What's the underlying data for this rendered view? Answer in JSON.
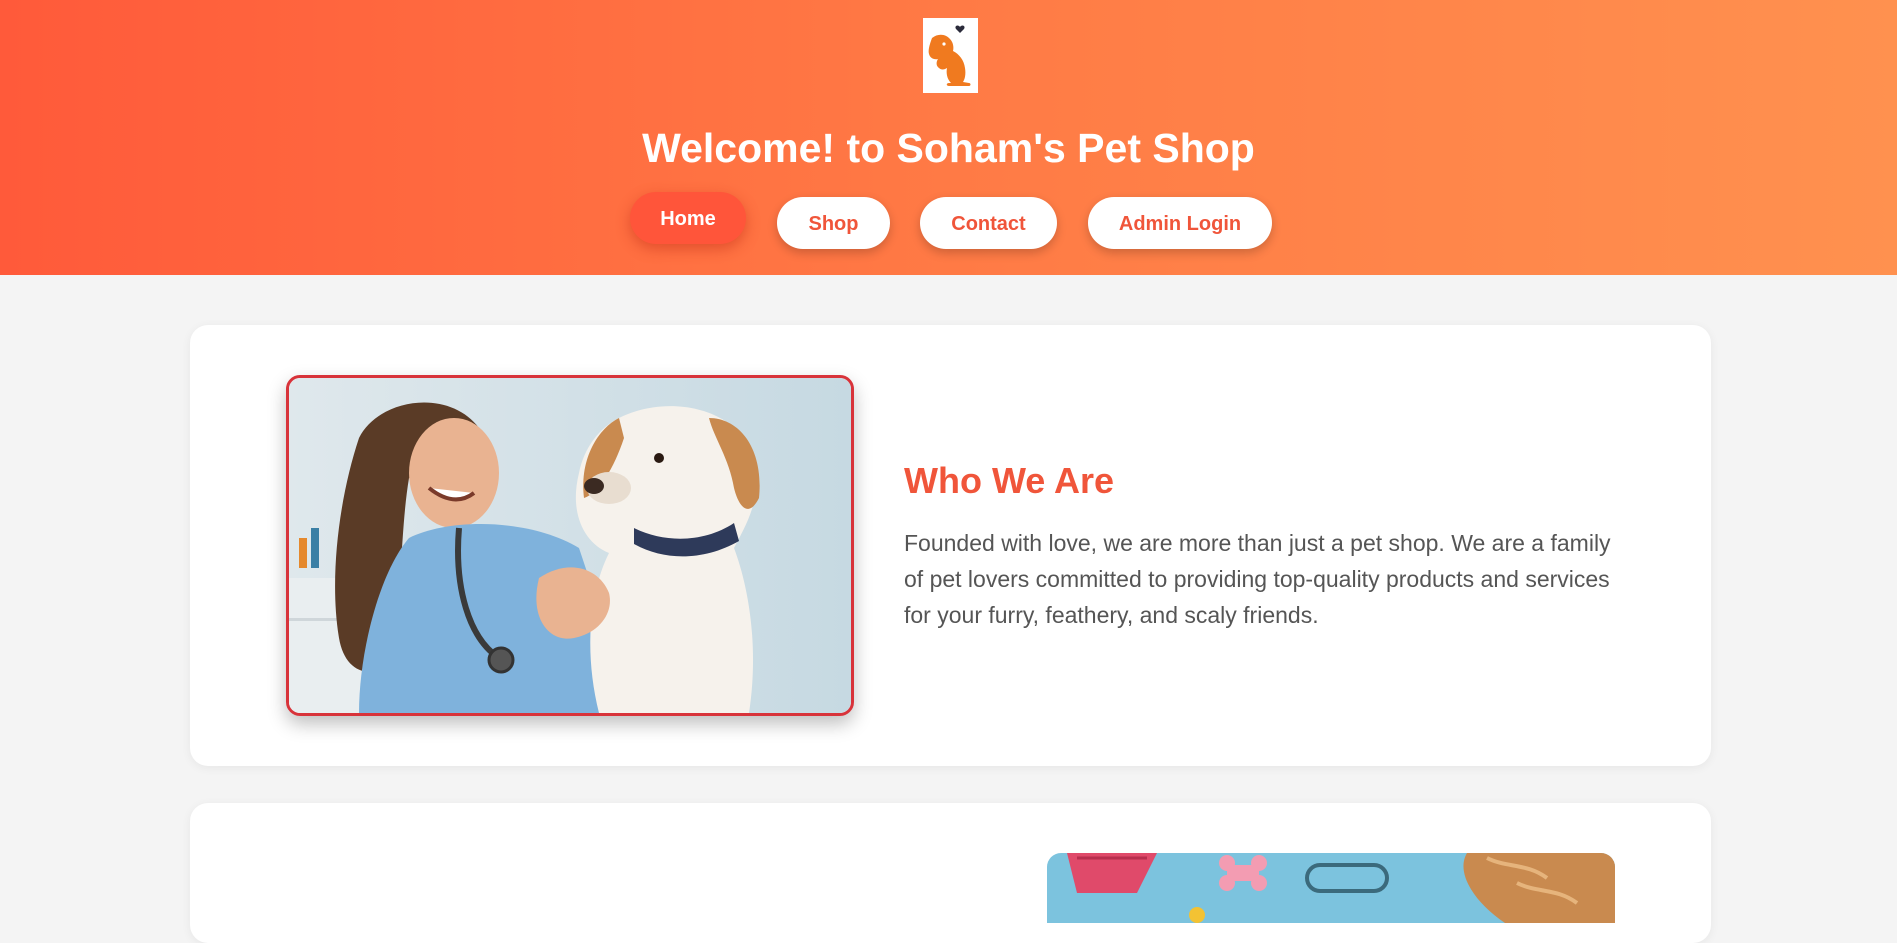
{
  "header": {
    "title": "Welcome! to Soham's Pet Shop",
    "logo_icon": "dog-silhouette-icon",
    "gradient_colors": [
      "#ff5a3a",
      "#ff914f"
    ]
  },
  "nav": {
    "items": [
      {
        "label": "Home",
        "active": true
      },
      {
        "label": "Shop",
        "active": false
      },
      {
        "label": "Contact",
        "active": false
      },
      {
        "label": "Admin Login",
        "active": false
      }
    ]
  },
  "about": {
    "heading": "Who We Are",
    "text": "Founded with love, we are more than just a pet shop. We are a family of pet lovers committed to providing top-quality products and services for your furry, feathery, and scaly friends.",
    "image_alt": "veterinarian-with-dog-photo"
  },
  "products_preview": {
    "image_alt": "pet-accessories-photo"
  },
  "colors": {
    "accent": "#f0553a",
    "page_background": "#f4f4f4",
    "card_background": "#ffffff",
    "image_border": "#d8333a"
  }
}
